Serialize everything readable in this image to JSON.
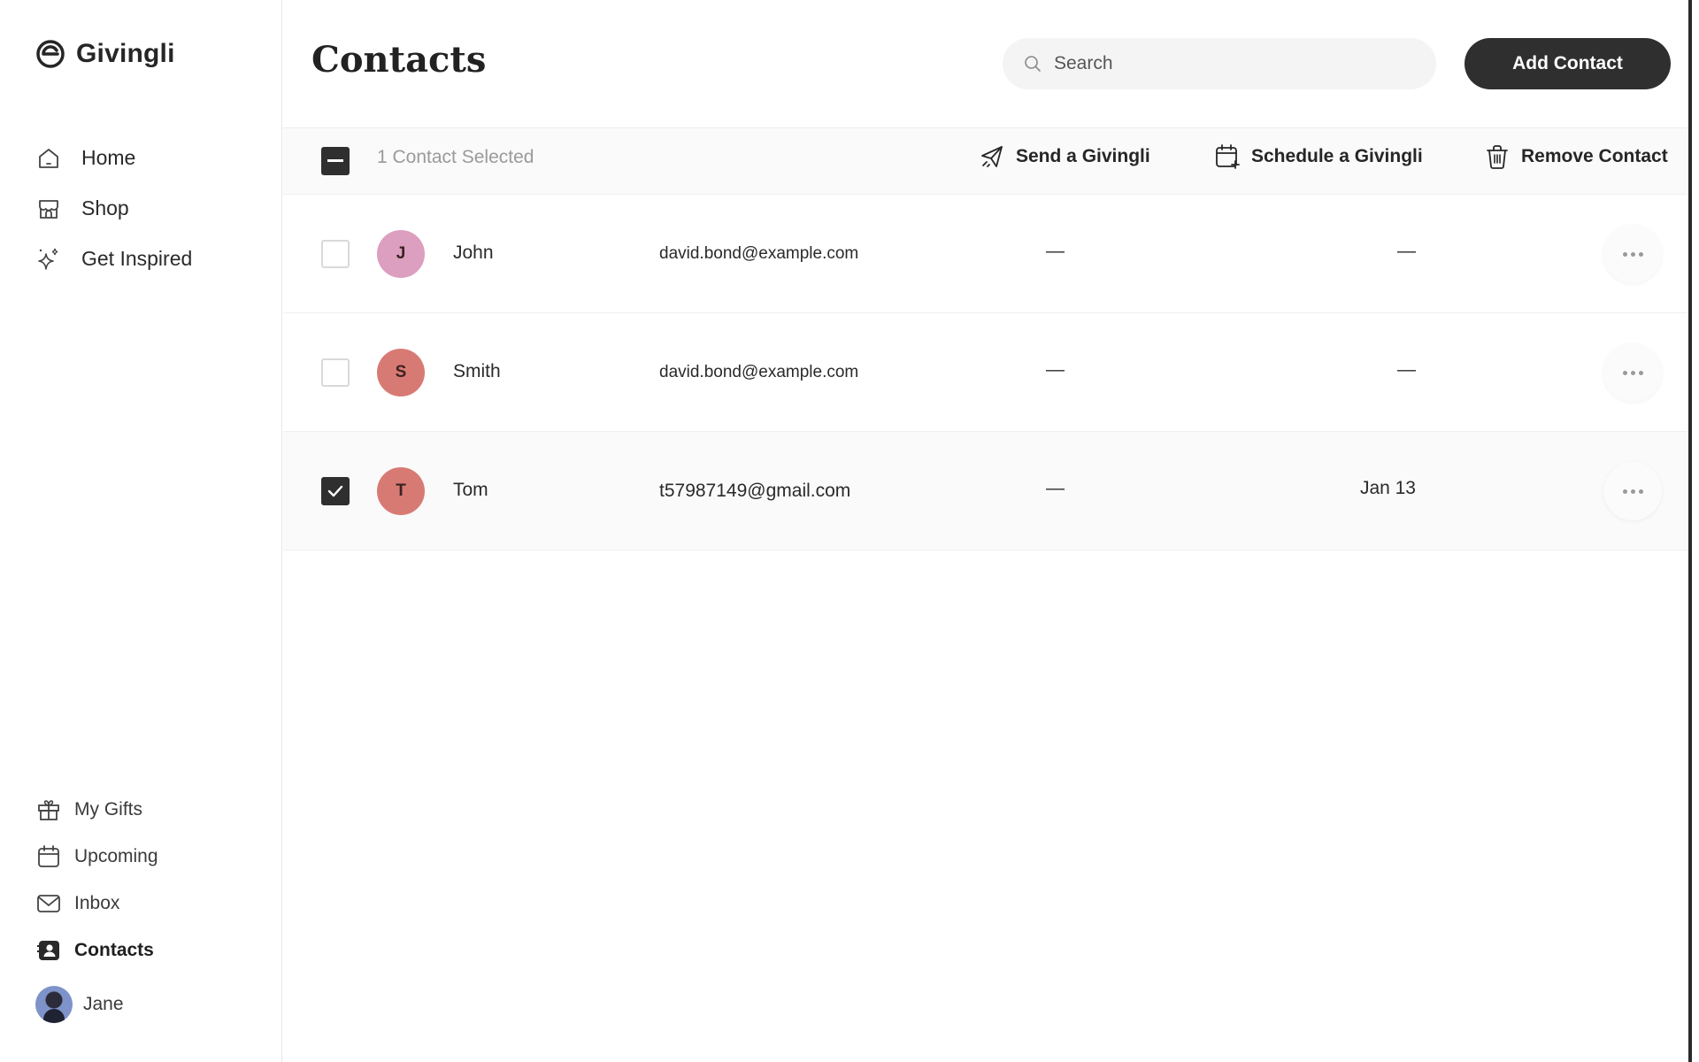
{
  "app": {
    "brand": "Givingli"
  },
  "nav_top": [
    {
      "label": "Home",
      "icon": "home-icon"
    },
    {
      "label": "Shop",
      "icon": "shop-icon"
    },
    {
      "label": "Get Inspired",
      "icon": "sparkle-icon"
    }
  ],
  "nav_bottom": [
    {
      "label": "My Gifts",
      "icon": "gift-icon"
    },
    {
      "label": "Upcoming",
      "icon": "calendar-icon"
    },
    {
      "label": "Inbox",
      "icon": "mail-icon"
    },
    {
      "label": "Contacts",
      "icon": "contacts-icon",
      "active": true
    }
  ],
  "user": {
    "name": "Jane"
  },
  "header": {
    "title": "Contacts",
    "search_placeholder": "Search",
    "add_label": "Add Contact"
  },
  "actionbar": {
    "selected_text": "1 Contact Selected",
    "send_label": "Send a Givingli",
    "schedule_label": "Schedule a Givingli",
    "remove_label": "Remove Contact"
  },
  "contacts": [
    {
      "initial": "J",
      "name": "John",
      "email": "david.bond@example.com",
      "col1": "—",
      "col2": "—",
      "avatar_color": "#dc9fbf",
      "checked": false
    },
    {
      "initial": "S",
      "name": "Smith",
      "email": "david.bond@example.com",
      "col1": "—",
      "col2": "—",
      "avatar_color": "#d87a74",
      "checked": false
    },
    {
      "initial": "T",
      "name": "Tom",
      "email": "t57987149@gmail.com",
      "col1": "—",
      "col2": "Jan 13",
      "avatar_color": "#d87a74",
      "checked": true
    }
  ],
  "colors": {
    "primary_dark": "#2f2f2f",
    "muted_text": "#9a9a9a"
  }
}
